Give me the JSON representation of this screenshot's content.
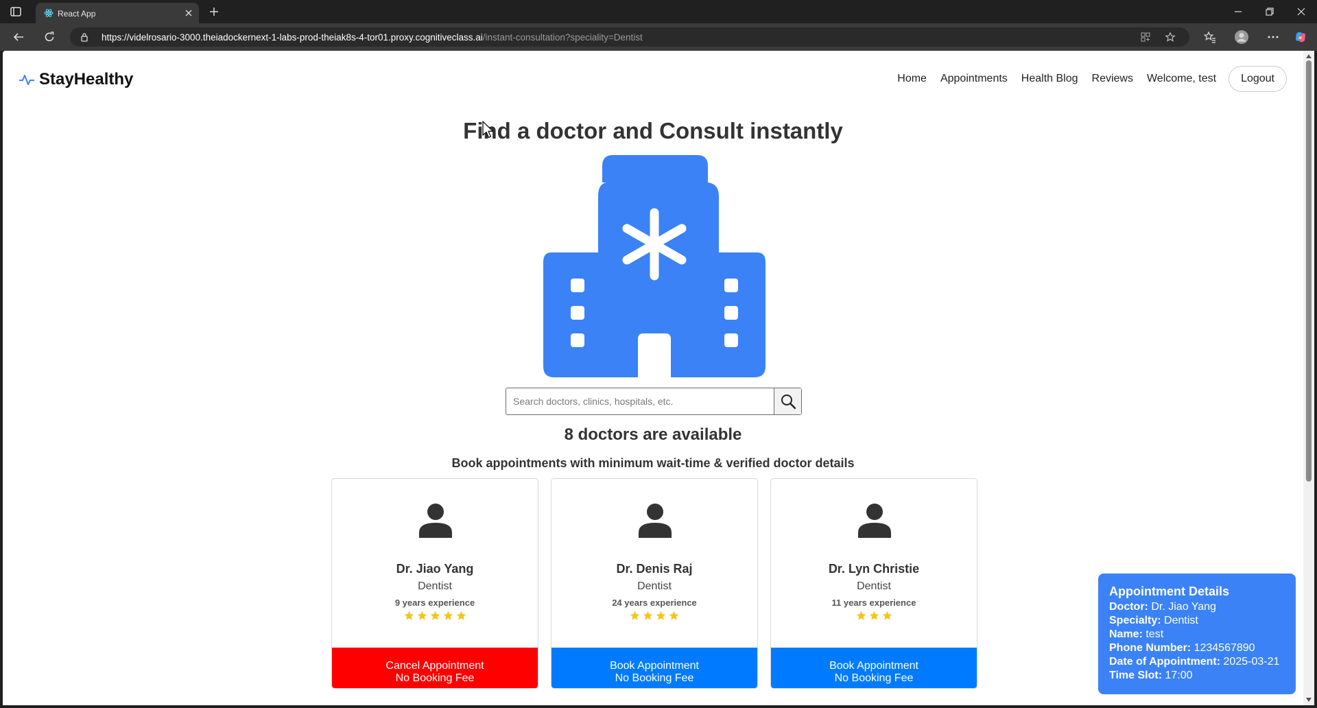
{
  "browser": {
    "tab_title": "React App",
    "url_host": "https://videlrosario-3000.theiadockernext-1-labs-prod-theiak8s-4-tor01.proxy.cognitiveclass.ai",
    "url_path": "/instant-consultation?speciality=Dentist"
  },
  "nav": {
    "brand": "StayHealthy",
    "links": [
      "Home",
      "Appointments",
      "Health Blog",
      "Reviews"
    ],
    "welcome": "Welcome, test",
    "logout": "Logout"
  },
  "page": {
    "title": "Find a doctor and Consult instantly",
    "search_placeholder": "Search doctors, clinics, hospitals, etc.",
    "available": "8 doctors are available",
    "subline": "Book appointments with minimum wait-time & verified doctor details"
  },
  "doctors": [
    {
      "name": "Dr. Jiao Yang",
      "speciality": "Dentist",
      "experience": "9 years experience",
      "rating": 5,
      "button_line1": "Cancel Appointment",
      "button_line2": "No Booking Fee",
      "button_color": "#ff0000"
    },
    {
      "name": "Dr. Denis Raj",
      "speciality": "Dentist",
      "experience": "24 years experience",
      "rating": 4,
      "button_line1": "Book Appointment",
      "button_line2": "No Booking Fee",
      "button_color": "#007bff"
    },
    {
      "name": "Dr. Lyn Christie",
      "speciality": "Dentist",
      "experience": "11 years experience",
      "rating": 3,
      "button_line1": "Book Appointment",
      "button_line2": "No Booking Fee",
      "button_color": "#007bff"
    }
  ],
  "appointment": {
    "title": "Appointment Details",
    "doctor_label": "Doctor:",
    "doctor": "Dr. Jiao Yang",
    "specialty_label": "Specialty:",
    "specialty": "Dentist",
    "name_label": "Name:",
    "name": "test",
    "phone_label": "Phone Number:",
    "phone": "1234567890",
    "date_label": "Date of Appointment:",
    "date": "2025-03-21",
    "time_label": "Time Slot:",
    "time": "17:00"
  },
  "colors": {
    "accent": "#3b82f6",
    "cancel": "#ff0000",
    "book": "#007bff",
    "star": "#f5c518"
  }
}
